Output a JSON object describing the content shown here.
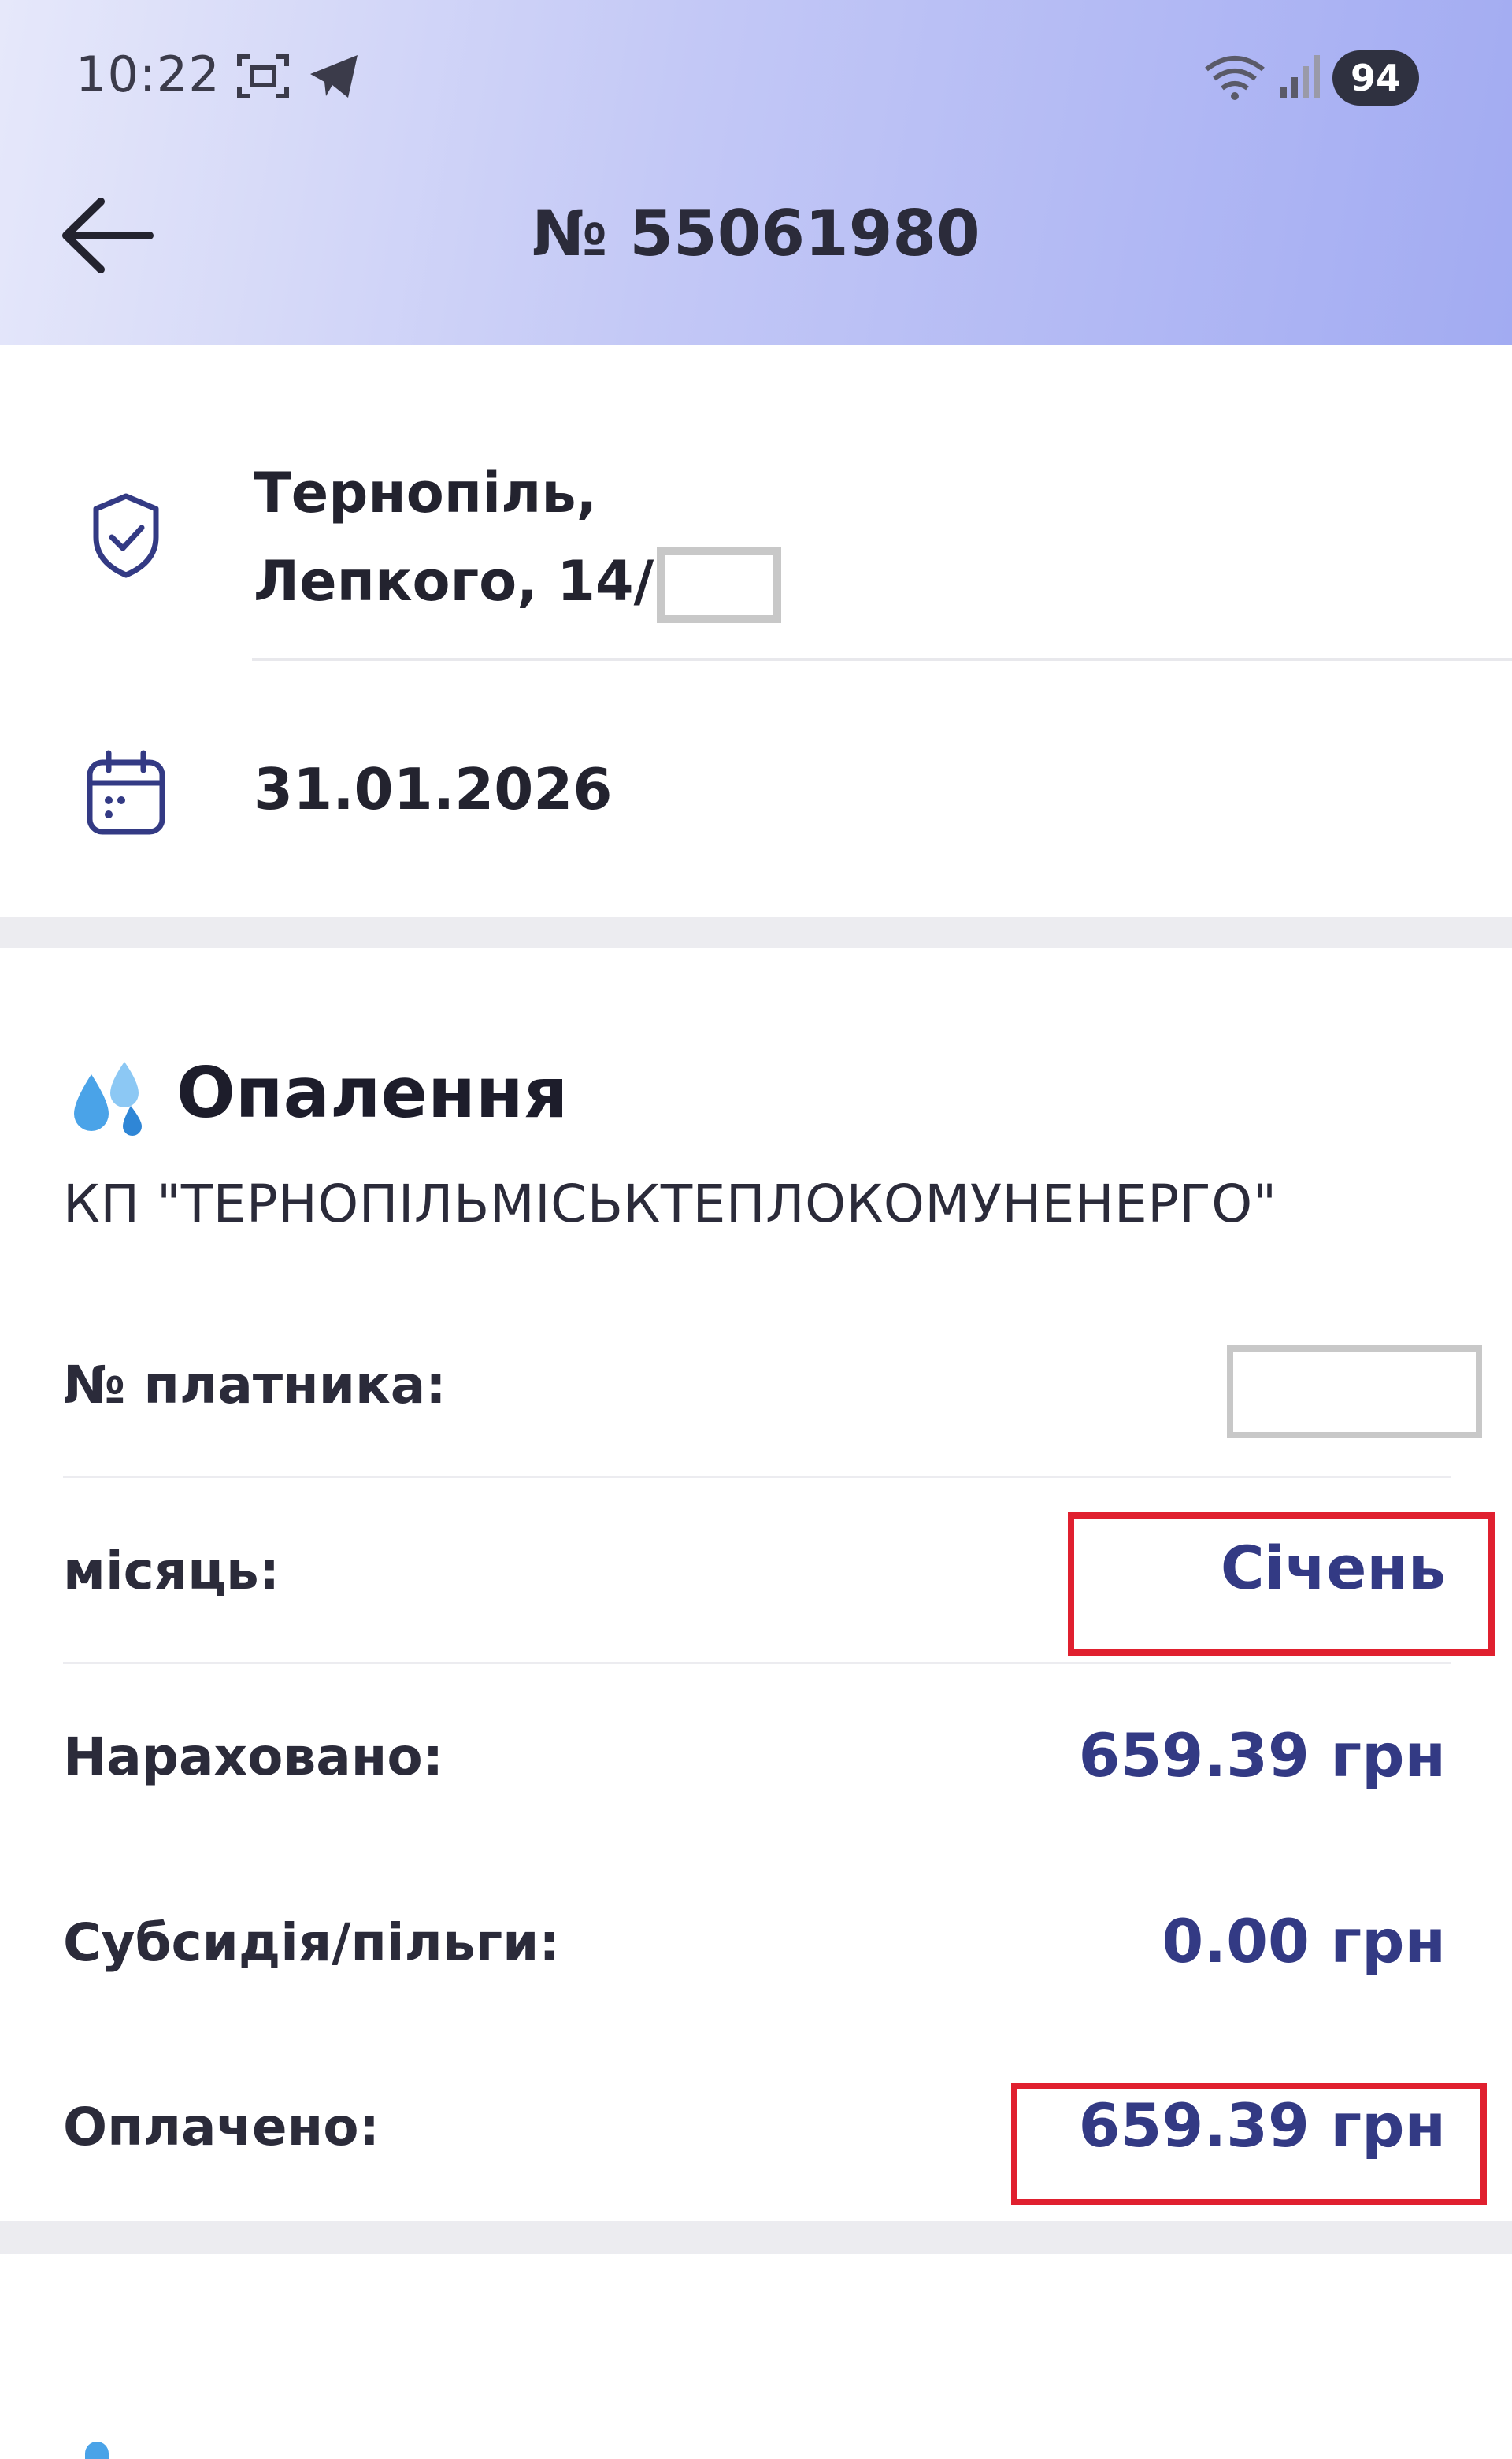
{
  "status_bar": {
    "time": "10:22",
    "battery": "94",
    "icons": [
      "screenshot-icon",
      "telegram-icon",
      "wifi-icon",
      "signal-icon"
    ]
  },
  "header": {
    "back_icon": "arrow-left-icon",
    "title": "№ 55061980"
  },
  "info": {
    "address_line1": "Тернопіль,",
    "address_line2": "Лепкого, 14/",
    "date": "31.01.2026"
  },
  "service": {
    "icon": "water-drops-icon",
    "title": "Опалення",
    "provider": "КП \"ТЕРНОПІЛЬМІСЬКТЕПЛОКОМУНЕНЕРГО\"",
    "rows": [
      {
        "label": "№ платника:",
        "value": ""
      },
      {
        "label": "місяць:",
        "value": "Січень"
      },
      {
        "label": "Нараховано:",
        "value": "659.39 грн"
      },
      {
        "label": "Субсидія/пільги:",
        "value": "0.00 грн"
      },
      {
        "label": "Оплачено:",
        "value": "659.39 грн"
      }
    ]
  },
  "colors": {
    "accent": "#333a84",
    "highlight": "#e0202f",
    "header_gradient_end": "#a2abf2"
  }
}
